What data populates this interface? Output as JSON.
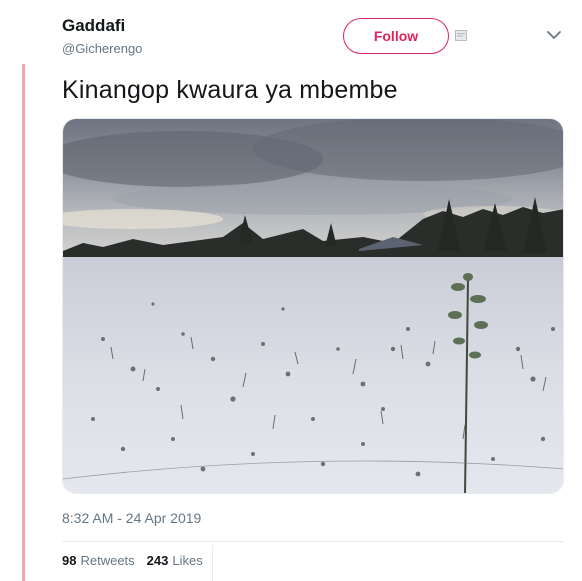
{
  "author": {
    "display_name": "Gaddafi",
    "handle": "@Gicherengo"
  },
  "actions": {
    "follow_label": "Follow"
  },
  "tweet": {
    "text": "Kinangop kwaura ya mbembe",
    "timestamp": "8:32 AM - 24 Apr 2019"
  },
  "stats": {
    "retweets_count": "98",
    "retweets_label": "Retweets",
    "likes_count": "243",
    "likes_label": "Likes"
  },
  "colors": {
    "accent": "#e0245e",
    "muted_text": "#657786",
    "left_rule": "#f0a8ae"
  },
  "icons": {
    "more": "chevron-down-icon",
    "badge": "small-square-icon"
  }
}
